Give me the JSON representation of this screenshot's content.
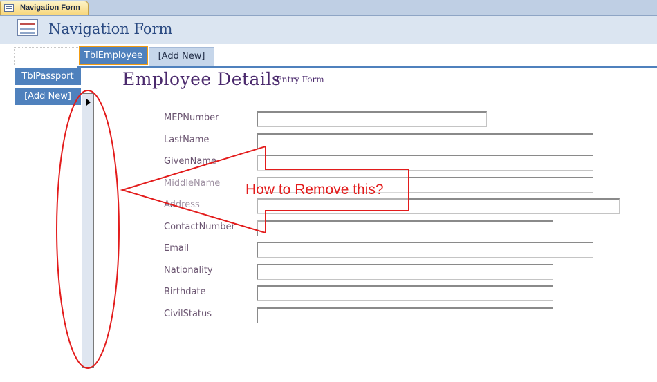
{
  "window_tab": {
    "title": "Navigation Form"
  },
  "header": {
    "title": "Navigation Form"
  },
  "nav_tabs": [
    {
      "label": "TblEmployee",
      "active": true
    },
    {
      "label": "[Add New]",
      "active": false
    }
  ],
  "side_nav": [
    {
      "label": "TblPassport"
    },
    {
      "label": "[Add New]"
    }
  ],
  "form": {
    "title": "Employee Details",
    "subtitle": "Entry Form",
    "fields": [
      {
        "label": "MEPNumber",
        "value": ""
      },
      {
        "label": "LastName",
        "value": ""
      },
      {
        "label": "GivenName",
        "value": ""
      },
      {
        "label": "MiddleName",
        "value": ""
      },
      {
        "label": "Address",
        "value": ""
      },
      {
        "label": "ContactNumber",
        "value": ""
      },
      {
        "label": "Email",
        "value": ""
      },
      {
        "label": "Nationality",
        "value": ""
      },
      {
        "label": "Birthdate",
        "value": ""
      },
      {
        "label": "CivilStatus",
        "value": ""
      }
    ]
  },
  "annotation": {
    "text": "How to Remove this?",
    "color": "#e31c1c"
  },
  "colors": {
    "accent": "#4f81bd",
    "selected_border": "#f39c12",
    "header_bg": "#dbe5f1"
  },
  "icons": [
    "form-icon",
    "record-pointer-icon"
  ]
}
